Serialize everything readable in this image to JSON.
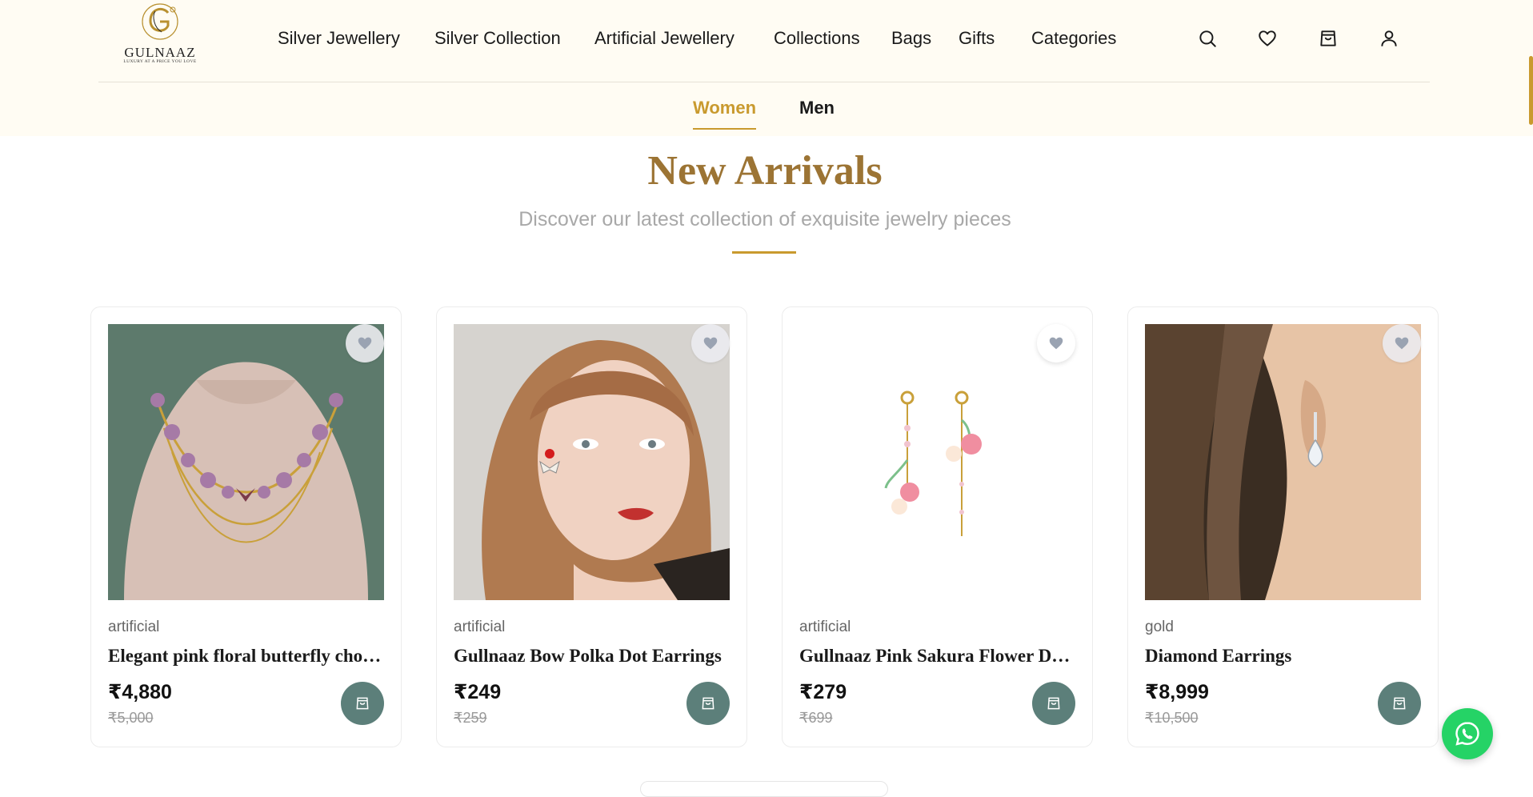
{
  "brand": {
    "name": "GULNAAZ",
    "tagline": "LUXURY AT A PRICE YOU LOVE"
  },
  "nav": {
    "items": [
      "Silver Jewellery",
      "Silver Collection",
      "Artificial Jewellery",
      "Collections",
      "Bags",
      "Gifts",
      "Categories"
    ]
  },
  "header_icons": [
    "search-icon",
    "heart-icon",
    "shopping-bag-icon",
    "user-icon"
  ],
  "gender_tabs": {
    "active": "Women",
    "other": "Men"
  },
  "section": {
    "title": "New Arrivals",
    "subtitle": "Discover our latest collection of exquisite jewelry pieces"
  },
  "products": [
    {
      "category": "artificial",
      "name": "Elegant pink floral butterfly choker necklace",
      "price": "₹4,880",
      "mrp": "₹5,000"
    },
    {
      "category": "artificial",
      "name": "Gullnaaz Bow Polka Dot Earrings",
      "price": "₹249",
      "mrp": "₹259"
    },
    {
      "category": "artificial",
      "name": "Gullnaaz Pink Sakura Flower Dangle Earrings",
      "price": "₹279",
      "mrp": "₹699"
    },
    {
      "category": "gold",
      "name": "Diamond Earrings",
      "price": "₹8,999",
      "mrp": "₹10,500"
    }
  ],
  "colors": {
    "accent_gold": "#c99a2e",
    "title_brown": "#9c7434",
    "cart_teal": "#5c7f7a",
    "header_bg": "#fffcf3",
    "whatsapp_green": "#25d366"
  }
}
